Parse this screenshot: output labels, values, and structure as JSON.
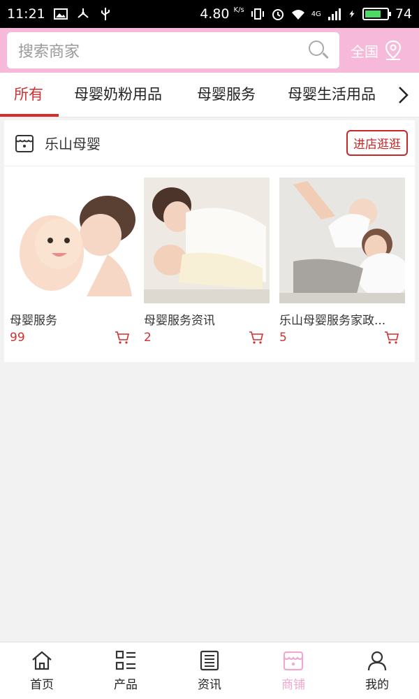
{
  "status_bar": {
    "time": "11:21",
    "speed": "4.80",
    "speed_unit": "K/s",
    "network": "4G",
    "battery": "74",
    "battery_level": 0.74
  },
  "search": {
    "placeholder": "搜索商家",
    "region_label": "全国"
  },
  "tabs": [
    {
      "label": "所有",
      "active": true
    },
    {
      "label": "母婴奶粉用品"
    },
    {
      "label": "母婴服务"
    },
    {
      "label": "母婴生活用品"
    }
  ],
  "shop": {
    "name": "乐山母婴",
    "enter_label": "进店逛逛",
    "products": [
      {
        "name": "母婴服务",
        "price": "99"
      },
      {
        "name": "母婴服务资讯",
        "price": "2"
      },
      {
        "name": "乐山母婴服务家政...",
        "price": "5"
      }
    ]
  },
  "bottom_nav": [
    {
      "label": "首页",
      "icon": "home-icon"
    },
    {
      "label": "产品",
      "icon": "grid-list-icon"
    },
    {
      "label": "资讯",
      "icon": "news-icon"
    },
    {
      "label": "商铺",
      "icon": "store-icon",
      "active": true
    },
    {
      "label": "我的",
      "icon": "user-icon"
    }
  ],
  "colors": {
    "header_bg": "#f7b9d9",
    "accent_red": "#d32f2f",
    "nav_active": "#f0a8cf"
  }
}
